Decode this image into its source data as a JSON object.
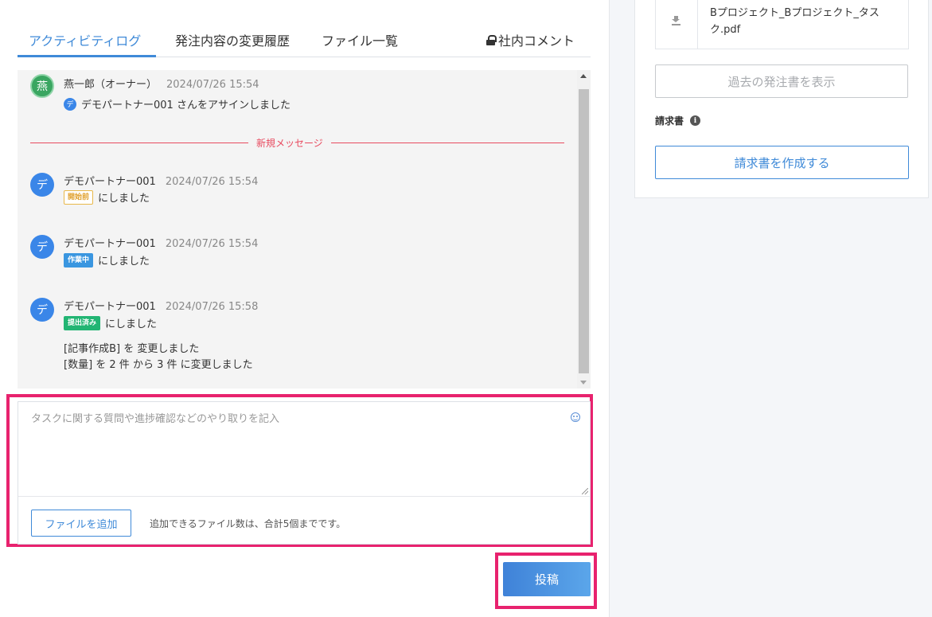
{
  "tabs": [
    {
      "label": "アクティビティログ",
      "active": true
    },
    {
      "label": "発注内容の変更履歴",
      "active": false
    },
    {
      "label": "ファイル一覧",
      "active": false
    }
  ],
  "private_tab": {
    "label": "社内コメント",
    "icon": "lock-icon"
  },
  "feed": {
    "entries": [
      {
        "avatar": "燕",
        "author": "燕一郎（オーナー）",
        "time": "2024/07/26 15:54",
        "mini_avatar": "デ",
        "text": "デモパートナー001 さんをアサインしました"
      },
      {
        "avatar": "デ",
        "author": "デモパートナー001",
        "time": "2024/07/26 15:54",
        "badge": "開始前",
        "text": "にしました"
      },
      {
        "avatar": "デ",
        "author": "デモパートナー001",
        "time": "2024/07/26 15:54",
        "badge": "作業中",
        "text": "にしました"
      },
      {
        "avatar": "デ",
        "author": "デモパートナー001",
        "time": "2024/07/26 15:58",
        "badge": "提出済み",
        "text": "にしました",
        "change1": "[記事作成B] を 変更しました",
        "change2": "[数量] を 2 件 から 3 件 に変更しました"
      }
    ],
    "new_message_label": "新規メッセージ"
  },
  "compose": {
    "placeholder": "タスクに関する質問や進捗確認などのやり取りを記入",
    "file_button": "ファイルを追加",
    "file_note": "追加できるファイル数は、合計5個までです。",
    "post_button": "投稿"
  },
  "sidebar": {
    "file_name": "Bプロジェクト_Bプロジェクト_タスク.pdf",
    "past_orders_button": "過去の発注書を表示",
    "invoice_label": "請求書",
    "invoice_info_glyph": "i",
    "create_invoice_button": "請求書を作成する"
  },
  "colors": {
    "accent": "#3f8ad8",
    "highlight": "#e8226e",
    "new_message": "#e84a5f",
    "badge_pending": "#e0a02c",
    "badge_working": "#3a96e0",
    "badge_done": "#22b573"
  }
}
